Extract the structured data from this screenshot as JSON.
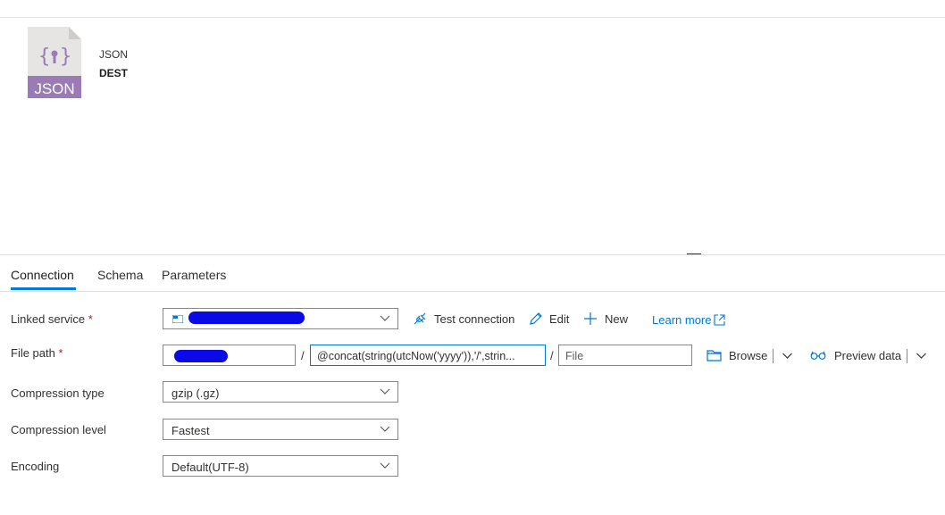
{
  "dataset": {
    "icon_label": "JSON",
    "type": "JSON",
    "name": "DEST"
  },
  "tabs": [
    {
      "label": "Connection",
      "active": true
    },
    {
      "label": "Schema",
      "active": false
    },
    {
      "label": "Parameters",
      "active": false
    }
  ],
  "form": {
    "linked_service": {
      "label": "Linked service",
      "required_mark": "*",
      "test_connection": "Test connection",
      "edit": "Edit",
      "new": "New",
      "learn_more": "Learn more"
    },
    "file_path": {
      "label": "File path",
      "required_mark": "*",
      "separator": "/",
      "directory_value": "@concat(string(utcNow('yyyy')),'/',strin...",
      "file_placeholder": "File",
      "browse": "Browse",
      "preview_data": "Preview data"
    },
    "compression_type": {
      "label": "Compression type",
      "value": "gzip (.gz)"
    },
    "compression_level": {
      "label": "Compression level",
      "value": "Fastest"
    },
    "encoding": {
      "label": "Encoding",
      "value": "Default(UTF-8)"
    }
  },
  "colors": {
    "accent": "#0078d4",
    "json_icon": "#9b7bb5",
    "redaction": "#0a0ae6"
  }
}
